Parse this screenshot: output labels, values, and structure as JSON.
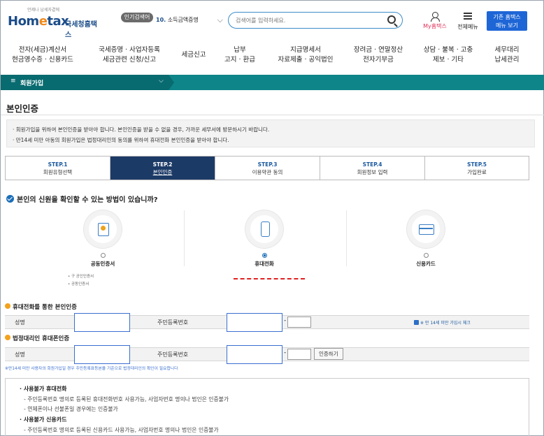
{
  "header": {
    "logo_tag": "언제나 납세자곁에",
    "logo_text": "Hometax",
    "logo_kr": "국세청홈택스",
    "popular_badge": "인기검색어",
    "popular_num": "10.",
    "popular_term": "소득금액증명",
    "search_placeholder": "검색어를 입력하세요.",
    "my_hometax": "My홈택스",
    "all_menu": "전체메뉴",
    "old_menu_line1": "기존 홈택스",
    "old_menu_line2": "메뉴 보기"
  },
  "gnb": [
    {
      "l1": "전자(세금)계산서",
      "l2": "현금영수증 · 신용카드"
    },
    {
      "l1": "국세증명 · 사업자등록",
      "l2": "세금관련 신청/신고"
    },
    {
      "l1": "세금신고",
      "l2": ""
    },
    {
      "l1": "납부",
      "l2": "고지 · 환급"
    },
    {
      "l1": "지급명세서",
      "l2": "자료제출 · 공익법인"
    },
    {
      "l1": "장려금 · 연말정산",
      "l2": "전자기부금"
    },
    {
      "l1": "상담 · 불복 · 고충",
      "l2": "제보 · 기타"
    },
    {
      "l1": "세무대리",
      "l2": "납세관리"
    }
  ],
  "subbar": {
    "label": "회원가입"
  },
  "page": {
    "title": "본인인증",
    "notice": [
      "· 회원가입을 위하여 본인인증을 받아야 합니다. 본인인증을 받을 수 없을 경우, 가까운 세무서에 방문하시기 바랍니다.",
      "· 만14세 미만 아동의 회원가입은 법정대리인의 동의를 위하여 휴대전화 본인인증을 받아야 합니다."
    ]
  },
  "steps": [
    {
      "num": "STEP.1",
      "label": "회원유형선택",
      "active": false
    },
    {
      "num": "STEP.2",
      "label": "본인인증",
      "active": true
    },
    {
      "num": "STEP.3",
      "label": "이용약관 동의",
      "active": false
    },
    {
      "num": "STEP.4",
      "label": "회원정보 입력",
      "active": false
    },
    {
      "num": "STEP.5",
      "label": "가입완료",
      "active": false
    }
  ],
  "question": "본인의 신원을 확인할 수 있는 방법이 있습니까?",
  "methods": [
    {
      "name": "공동인증서",
      "selected": false,
      "icon": "certificate-icon"
    },
    {
      "name": "휴대전화",
      "selected": true,
      "icon": "mobile-phone-icon"
    },
    {
      "name": "신용카드",
      "selected": false,
      "icon": "credit-card-icon"
    }
  ],
  "cert_sub": [
    "• 구 공인인증서",
    "• 공동인증서"
  ],
  "phone_section": {
    "title": "휴대전화를 통한 본인인증",
    "name_label": "성명",
    "rrn_label": "주민등록번호",
    "under14": "※ 만 14세 미만 가입시 체크"
  },
  "guardian_section": {
    "title": "법정대리인 휴대폰인증",
    "name_label": "성명",
    "rrn_label": "주민등록번호",
    "auth_button": "인증하기"
  },
  "small_note": "※만14세 미만 사용자의 회원가입일 경우 주민등록표등본을 기준으로 법정대리인의 확인이 필요합니다",
  "guide": [
    {
      "type": "t",
      "text": "· 사용불가 휴대전화"
    },
    {
      "type": "d",
      "text": "- 주민등록번호 명의로 등록된 휴대전화번호 사용가능, 사업자번호 명의나 법인은 인증불가"
    },
    {
      "type": "d",
      "text": "- 연체폰이나 선불폰일 경우에는 인증불가"
    },
    {
      "type": "t",
      "text": "· 사용불가 신용카드"
    },
    {
      "type": "d",
      "text": "- 주민등록번호 명의로 등록된 신용카드 사용가능, 사업자번호 명의나 법인은 인증불가"
    }
  ]
}
